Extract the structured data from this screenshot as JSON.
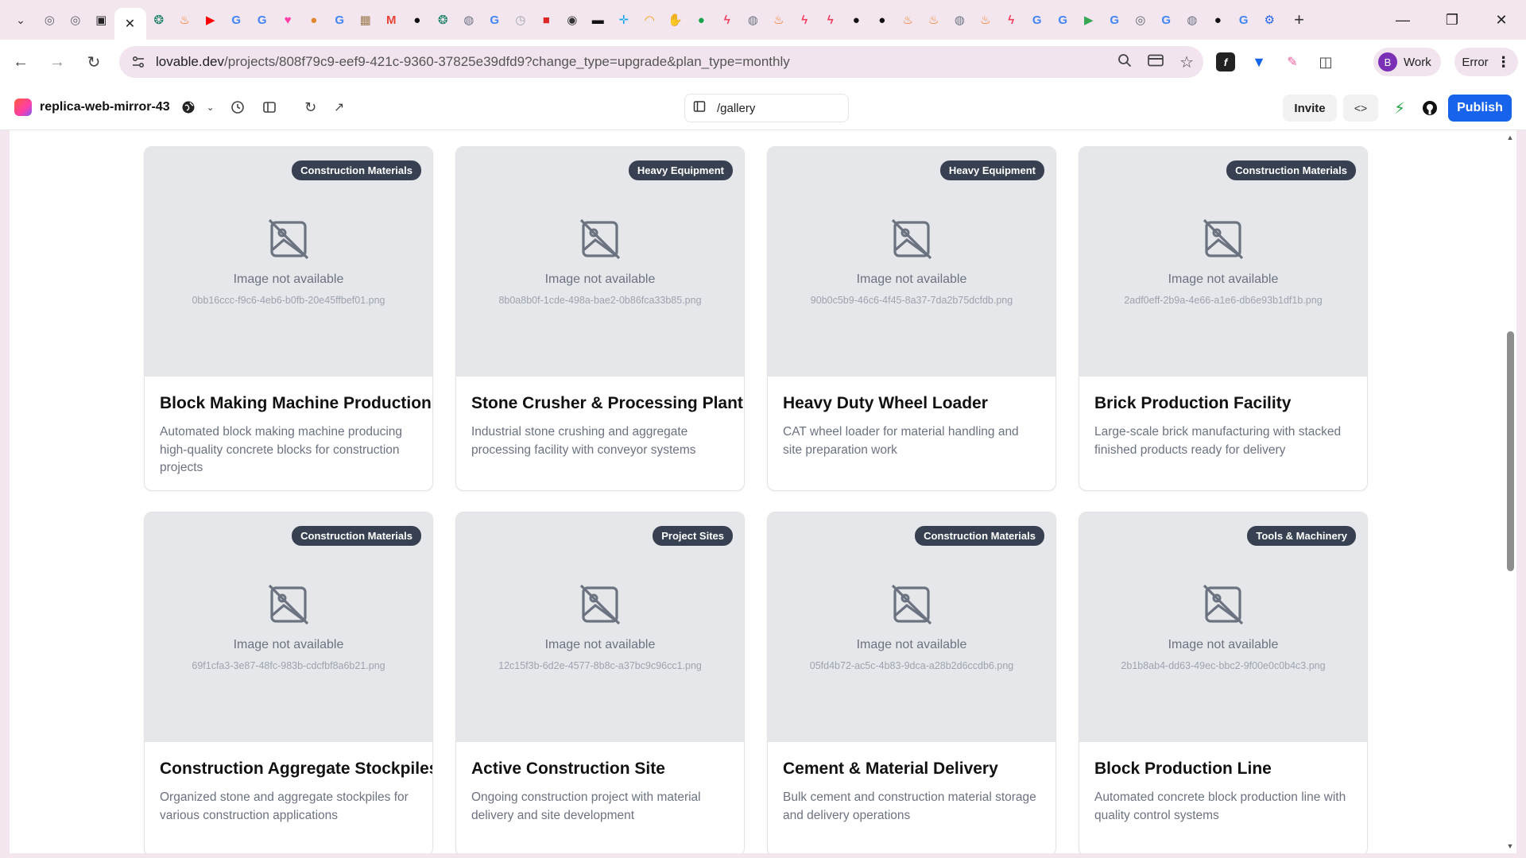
{
  "browser": {
    "url_domain": "lovable.dev",
    "url_path": "/projects/808f79c9-eef9-421c-9360-37825e39dfd9?change_type=upgrade&plan_type=monthly",
    "profile_initial": "B",
    "profile_label": "Work",
    "error_label": "Error",
    "tab_favicons": [
      "chrome",
      "chrome",
      "darkbox",
      "close",
      "openai",
      "fire",
      "youtube",
      "google",
      "google",
      "lovable",
      "orange",
      "google",
      "img",
      "gmail",
      "github",
      "openai",
      "globe",
      "google",
      "clock",
      "red",
      "robot",
      "terminal",
      "plus",
      "rainbow",
      "hand",
      "green",
      "bolt",
      "globe",
      "fire",
      "bolt",
      "bolt",
      "github",
      "github",
      "fire",
      "fire",
      "globe",
      "fire",
      "bolt",
      "google",
      "google",
      "play",
      "google",
      "chrome",
      "google",
      "globe",
      "github",
      "google",
      "gear"
    ]
  },
  "lovable": {
    "project_name": "replica-web-mirror-43",
    "path": "/gallery",
    "invite_label": "Invite",
    "publish_label": "Publish",
    "accent": "#1763ec"
  },
  "gallery": {
    "placeholder_text": "Image not available",
    "items": [
      {
        "badge": "Construction Materials",
        "file": "0bb16ccc-f9c6-4eb6-b0fb-20e45ffbef01.png",
        "title": "Block Making Machine Production",
        "desc": "Automated block making machine producing high-quality concrete blocks for construction projects"
      },
      {
        "badge": "Heavy Equipment",
        "file": "8b0a8b0f-1cde-498a-bae2-0b86fca33b85.png",
        "title": "Stone Crusher & Processing Plant",
        "desc": "Industrial stone crushing and aggregate processing facility with conveyor systems"
      },
      {
        "badge": "Heavy Equipment",
        "file": "90b0c5b9-46c6-4f45-8a37-7da2b75dcfdb.png",
        "title": "Heavy Duty Wheel Loader",
        "desc": "CAT wheel loader for material handling and site preparation work"
      },
      {
        "badge": "Construction Materials",
        "file": "2adf0eff-2b9a-4e66-a1e6-db6e93b1df1b.png",
        "title": "Brick Production Facility",
        "desc": "Large-scale brick manufacturing with stacked finished products ready for delivery"
      },
      {
        "badge": "Construction Materials",
        "file": "69f1cfa3-3e87-48fc-983b-cdcfbf8a6b21.png",
        "title": "Construction Aggregate Stockpiles",
        "desc": "Organized stone and aggregate stockpiles for various construction applications"
      },
      {
        "badge": "Project Sites",
        "file": "12c15f3b-6d2e-4577-8b8c-a37bc9c96cc1.png",
        "title": "Active Construction Site",
        "desc": "Ongoing construction project with material delivery and site development"
      },
      {
        "badge": "Construction Materials",
        "file": "05fd4b72-ac5c-4b83-9dca-a28b2d6ccdb6.png",
        "title": "Cement & Material Delivery",
        "desc": "Bulk cement and construction material storage and delivery operations"
      },
      {
        "badge": "Tools & Machinery",
        "file": "2b1b8ab4-dd63-49ec-bbc2-9f00e0c0b4c3.png",
        "title": "Block Production Line",
        "desc": "Automated concrete block production line with quality control systems"
      }
    ]
  }
}
